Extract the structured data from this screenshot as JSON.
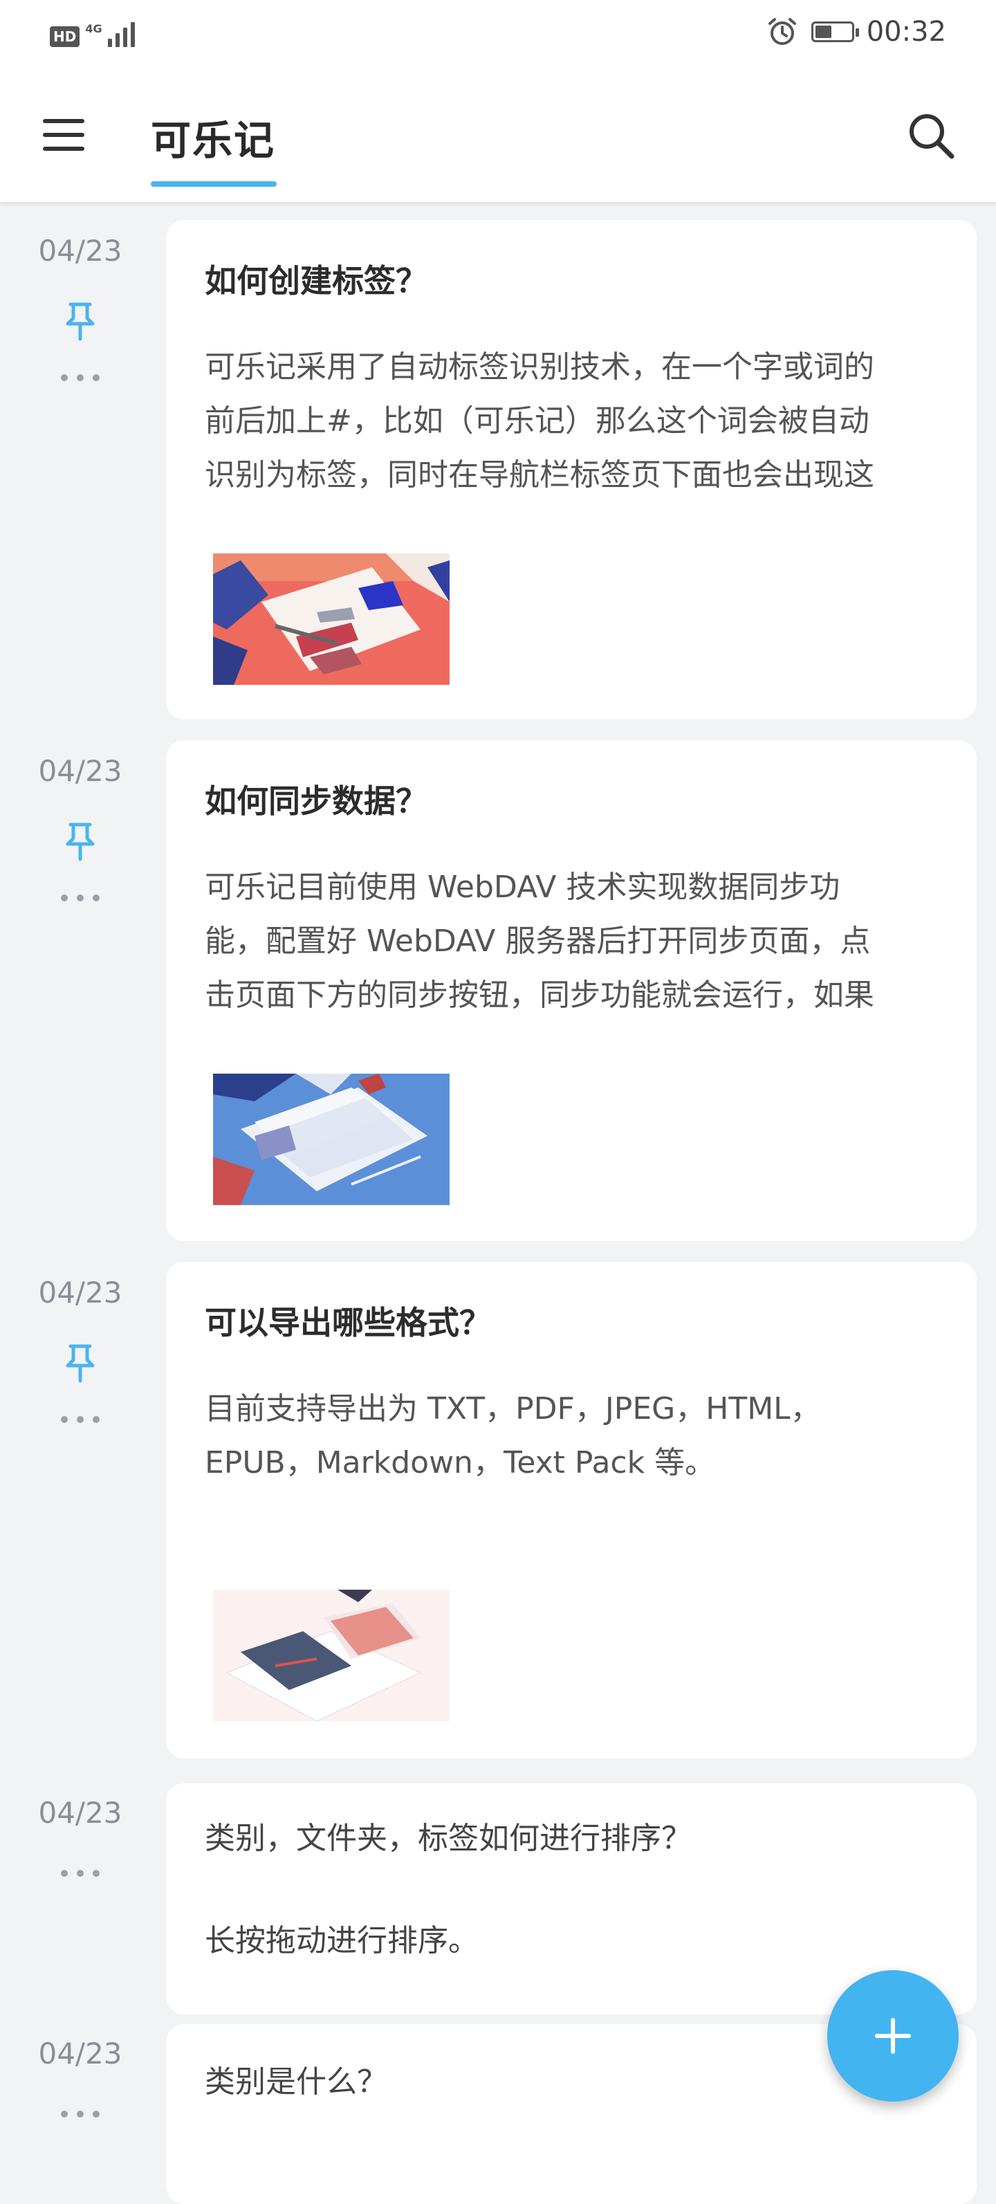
{
  "status_bar": {
    "hd_label": "HD",
    "network_label": "4G",
    "time": "00:32",
    "battery_level": 0.45,
    "icons": [
      "alarm-icon",
      "battery-icon",
      "signal-icon"
    ]
  },
  "app_bar": {
    "title": "可乐记",
    "menu_icon": "menu-icon",
    "search_icon": "search-icon",
    "accent": "#4ab4f0"
  },
  "notes": [
    {
      "date": "04/23",
      "pinned": true,
      "title": "如何创建标签？",
      "body_lines": [
        "可乐记采用了自动标签识别技术，在一个字或词的",
        "前后加上#，比如（可乐记）那么这个词会被自动",
        "识别为标签，同时在导航栏标签页下面也会出现这"
      ],
      "has_image": true
    },
    {
      "date": "04/23",
      "pinned": true,
      "title": "如何同步数据？",
      "body_lines": [
        "可乐记目前使用 WebDAV 技术实现数据同步功",
        "能，配置好 WebDAV 服务器后打开同步页面，点",
        "击页面下方的同步按钮，同步功能就会运行，如果"
      ],
      "has_image": true
    },
    {
      "date": "04/23",
      "pinned": true,
      "title": "可以导出哪些格式？",
      "body_lines": [
        "目前支持导出为 TXT，PDF，JPEG，HTML，",
        "EPUB，Markdown，Text Pack 等。"
      ],
      "has_image": true
    },
    {
      "date": "04/23",
      "pinned": false,
      "lines": [
        "类别，文件夹，标签如何进行排序？",
        "长按拖动进行排序。"
      ]
    },
    {
      "date": "04/23",
      "pinned": false,
      "lines": [
        "类别是什么？"
      ]
    }
  ],
  "fab": {
    "icon": "plus-icon",
    "color": "#42b4f0"
  }
}
